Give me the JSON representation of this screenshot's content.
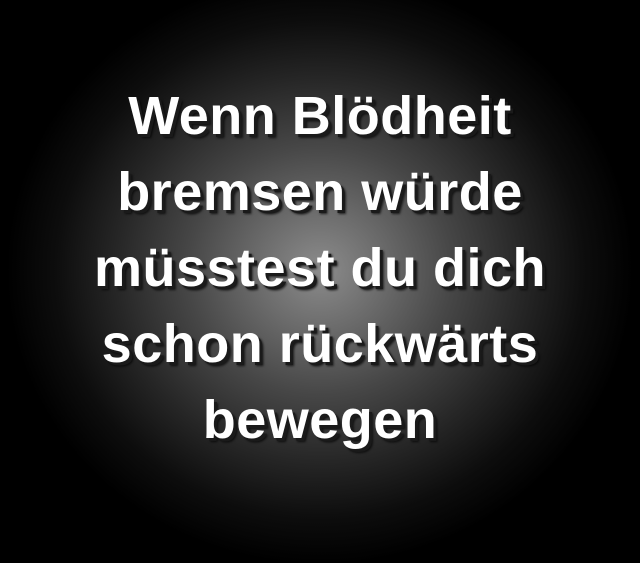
{
  "quote": {
    "lines": [
      "Wenn Blödheit",
      "bremsen würde",
      "müsstest du dich",
      "schon rückwärts",
      "bewegen"
    ]
  },
  "colors": {
    "background": "#000000",
    "glow": "#8c8c8c",
    "text": "#ffffff",
    "shadow": "#1a1a1a"
  }
}
